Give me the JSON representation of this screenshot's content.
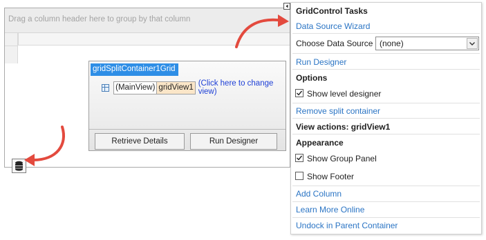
{
  "grid": {
    "group_panel_text": "Drag a column header here to group by that column",
    "split_container_label": "gridSplitContainer1Grid",
    "main_view_label": "(MainView)",
    "view_name": "gridView1",
    "change_view_link": "(Click here to change view)",
    "retrieve_details_label": "Retrieve Details",
    "run_designer_label": "Run Designer"
  },
  "tasks": {
    "title": "GridControl Tasks",
    "data_source_wizard": "Data Source Wizard",
    "choose_data_source_label": "Choose Data Source",
    "data_source_value": "(none)",
    "run_designer": "Run Designer",
    "options_header": "Options",
    "show_level_designer": {
      "label": "Show level designer",
      "checked": true
    },
    "remove_split_container": "Remove split container",
    "view_actions_header": "View actions: gridView1",
    "appearance_header": "Appearance",
    "show_group_panel": {
      "label": "Show Group Panel",
      "checked": true
    },
    "show_footer": {
      "label": "Show Footer",
      "checked": false
    },
    "add_column": "Add Column",
    "learn_more_online": "Learn More Online",
    "undock": "Undock in Parent Container"
  },
  "icons": {
    "database": "database-icon",
    "smart_tag": "smart-tag-arrow-icon",
    "view": "grid-view-icon",
    "dropdown": "chevron-down-icon",
    "check": "checkmark-icon"
  },
  "colors": {
    "link": "#2a74c4",
    "selected_label": "#2e8ee6",
    "annotation_arrow": "#e34a3e",
    "view_chip": "#fbe6c8"
  }
}
